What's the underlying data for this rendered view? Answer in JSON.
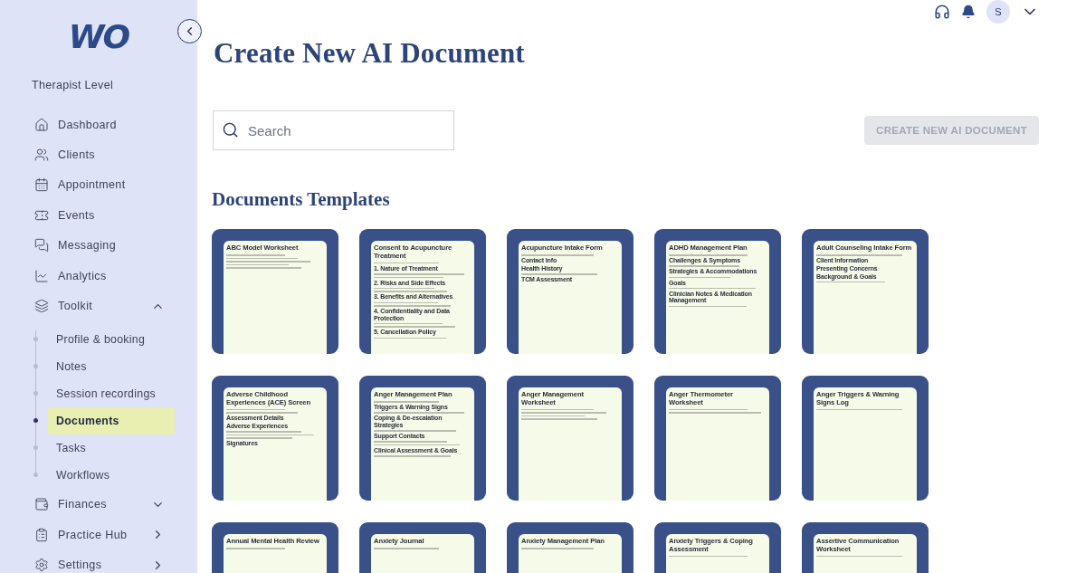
{
  "sidebar": {
    "logo": "WO",
    "level": "Therapist Level",
    "items": [
      {
        "label": "Dashboard",
        "kind": "link"
      },
      {
        "label": "Clients",
        "kind": "link"
      },
      {
        "label": "Appointment",
        "kind": "link"
      },
      {
        "label": "Events",
        "kind": "link"
      },
      {
        "label": "Messaging",
        "kind": "link"
      },
      {
        "label": "Analytics",
        "kind": "link"
      },
      {
        "label": "Toolkit",
        "kind": "group",
        "expanded": true,
        "children": [
          {
            "label": "Profile & booking",
            "selected": false
          },
          {
            "label": "Notes",
            "selected": false
          },
          {
            "label": "Session recordings",
            "selected": false
          },
          {
            "label": "Documents",
            "selected": true
          },
          {
            "label": "Tasks",
            "selected": false
          },
          {
            "label": "Workflows",
            "selected": false
          }
        ]
      },
      {
        "label": "Finances",
        "kind": "group",
        "expanded": false
      },
      {
        "label": "Practice Hub",
        "kind": "submenu"
      },
      {
        "label": "Settings",
        "kind": "submenu"
      }
    ]
  },
  "header": {
    "avatar": "S"
  },
  "page": {
    "title": "Create New AI Document",
    "search": {
      "placeholder": "Search"
    },
    "create_button": {
      "label": "CREATE NEW AI DOCUMENT",
      "disabled": true
    },
    "section_title": "Documents Templates"
  },
  "templates": [
    {
      "title": "ABC Model Worksheet",
      "blocks": [
        {
          "kind": "note"
        },
        {
          "kind": "note"
        },
        {
          "kind": "note"
        },
        {
          "kind": "note"
        },
        {
          "kind": "note"
        }
      ]
    },
    {
      "title": "Consent to Acupuncture Treatment",
      "blocks": [
        {
          "kind": "note"
        },
        {
          "kind": "heading",
          "text": "1. Nature of Treatment"
        },
        {
          "kind": "note"
        },
        {
          "kind": "note"
        },
        {
          "kind": "heading",
          "text": "2. Risks and Side Effects"
        },
        {
          "kind": "note"
        },
        {
          "kind": "note"
        },
        {
          "kind": "heading",
          "text": "3. Benefits and Alternatives"
        },
        {
          "kind": "note"
        },
        {
          "kind": "note"
        },
        {
          "kind": "heading",
          "text": "4. Confidentiality and Data Protection"
        },
        {
          "kind": "note"
        },
        {
          "kind": "note"
        },
        {
          "kind": "heading",
          "text": "5. Cancellation Policy"
        },
        {
          "kind": "note"
        }
      ]
    },
    {
      "title": "Acupuncture Intake Form",
      "blocks": [
        {
          "kind": "note"
        },
        {
          "kind": "heading",
          "text": "Contact Info"
        },
        {
          "kind": "heading",
          "text": "Health History"
        },
        {
          "kind": "note"
        },
        {
          "kind": "heading",
          "text": "TCM Assessment"
        }
      ]
    },
    {
      "title": "ADHD Management Plan",
      "blocks": [
        {
          "kind": "note"
        },
        {
          "kind": "heading",
          "text": "Challenges & Symptoms"
        },
        {
          "kind": "note"
        },
        {
          "kind": "heading",
          "text": "Strategies & Accommodations"
        },
        {
          "kind": "note"
        },
        {
          "kind": "heading",
          "text": "Goals"
        },
        {
          "kind": "note"
        },
        {
          "kind": "heading",
          "text": "Clinician Notes & Medication Management"
        },
        {
          "kind": "note"
        }
      ]
    },
    {
      "title": "Adult Counseling Intake Form",
      "blocks": [
        {
          "kind": "note"
        },
        {
          "kind": "heading",
          "text": "Client Information"
        },
        {
          "kind": "heading",
          "text": "Presenting Concerns"
        },
        {
          "kind": "heading",
          "text": "Background & Goals"
        },
        {
          "kind": "note"
        }
      ]
    },
    {
      "title": "Adverse Childhood Experiences (ACE) Screen",
      "blocks": [
        {
          "kind": "note"
        },
        {
          "kind": "note"
        },
        {
          "kind": "heading",
          "text": "Assessment Details"
        },
        {
          "kind": "heading",
          "text": "Adverse Experiences"
        },
        {
          "kind": "note"
        },
        {
          "kind": "note"
        },
        {
          "kind": "note"
        },
        {
          "kind": "heading",
          "text": "Signatures"
        }
      ]
    },
    {
      "title": "Anger Management Plan",
      "blocks": [
        {
          "kind": "note"
        },
        {
          "kind": "heading",
          "text": "Triggers & Warning Signs"
        },
        {
          "kind": "note"
        },
        {
          "kind": "heading",
          "text": "Coping & De-escalation Strategies"
        },
        {
          "kind": "note"
        },
        {
          "kind": "heading",
          "text": "Support Contacts"
        },
        {
          "kind": "note"
        },
        {
          "kind": "note"
        },
        {
          "kind": "heading",
          "text": "Clinical Assessment & Goals"
        },
        {
          "kind": "note"
        }
      ]
    },
    {
      "title": "Anger Management Worksheet",
      "blocks": [
        {
          "kind": "note"
        },
        {
          "kind": "note"
        },
        {
          "kind": "note"
        },
        {
          "kind": "note"
        }
      ]
    },
    {
      "title": "Anger Thermometer Worksheet",
      "blocks": [
        {
          "kind": "note"
        },
        {
          "kind": "note"
        }
      ]
    },
    {
      "title": "Anger Triggers & Warning Signs Log",
      "blocks": [
        {
          "kind": "note"
        }
      ]
    },
    {
      "title": "Annual Mental Health Review",
      "blocks": [
        {
          "kind": "note"
        }
      ]
    },
    {
      "title": "Anxiety Journal",
      "blocks": [
        {
          "kind": "note"
        }
      ]
    },
    {
      "title": "Anxiety Management Plan",
      "blocks": [
        {
          "kind": "note"
        }
      ]
    },
    {
      "title": "Anxiety Triggers & Coping Assessment",
      "blocks": [
        {
          "kind": "note"
        }
      ]
    },
    {
      "title": "Assertive Communication Worksheet",
      "blocks": [
        {
          "kind": "note"
        }
      ]
    }
  ]
}
